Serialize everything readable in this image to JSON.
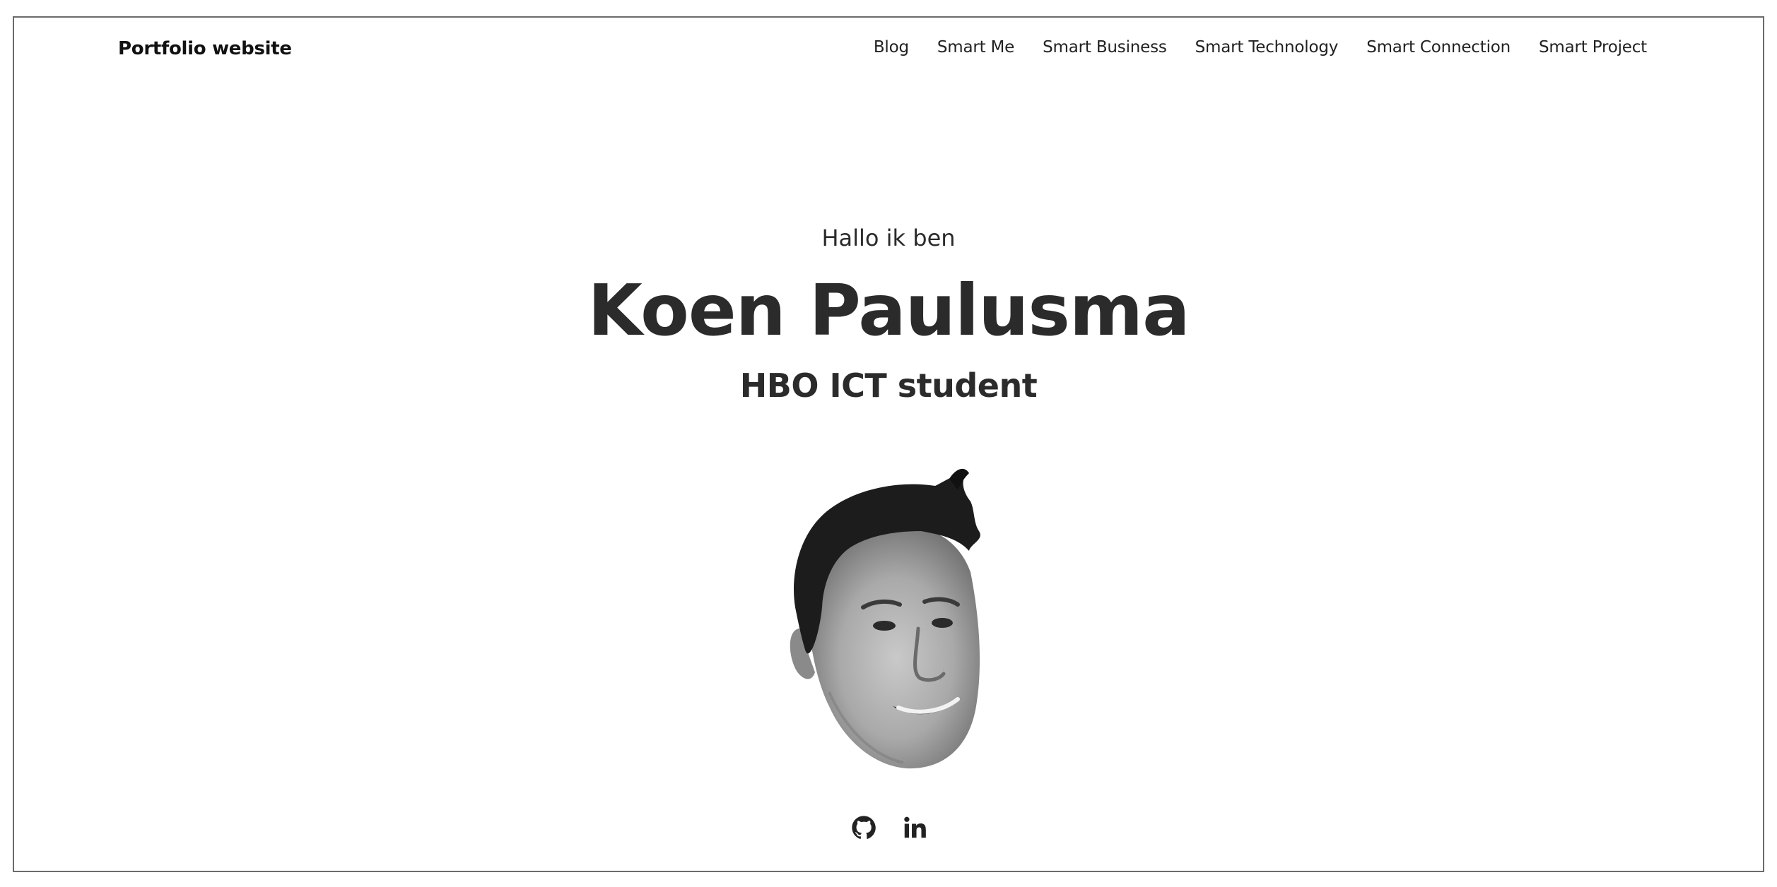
{
  "brand": "Portfolio website",
  "nav": {
    "items": [
      {
        "label": "Blog"
      },
      {
        "label": "Smart Me"
      },
      {
        "label": "Smart Business"
      },
      {
        "label": "Smart Technology"
      },
      {
        "label": "Smart Connection"
      },
      {
        "label": "Smart Project"
      }
    ]
  },
  "hero": {
    "greeting": "Hallo ik ben",
    "name": "Koen Paulusma",
    "role": "HBO ICT student"
  },
  "socials": [
    {
      "icon": "github-icon"
    },
    {
      "icon": "linkedin-icon"
    }
  ],
  "colors": {
    "text": "#2b2b2b",
    "background": "#ffffff",
    "border": "#6b6b6b"
  }
}
